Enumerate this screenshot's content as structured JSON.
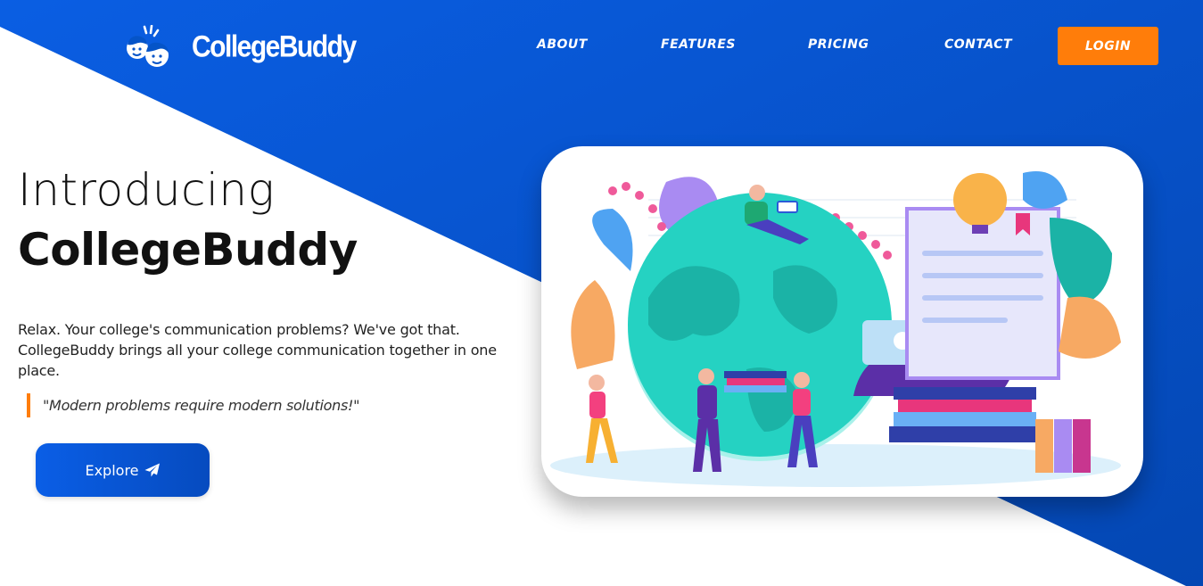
{
  "brand": {
    "name": "CollegeBuddy",
    "logo_icon": "two-faces-icon"
  },
  "nav": {
    "items": [
      {
        "label": "ABOUT"
      },
      {
        "label": "FEATURES"
      },
      {
        "label": "PRICING"
      },
      {
        "label": "CONTACT"
      }
    ],
    "login_label": "LOGIN"
  },
  "hero": {
    "title_line1": "Introducing",
    "title_line2": "CollegeBuddy",
    "description": "Relax. Your college's communication problems? We've got that. CollegeBuddy brings all your college communication together in one place.",
    "quote": "\"Modern problems require modern solutions!\"",
    "explore_label": "Explore",
    "explore_icon": "paper-plane-icon",
    "illustration": "students-globe-illustration"
  },
  "colors": {
    "primary_blue": "#0554c8",
    "accent_orange": "#ff7d0a",
    "text_dark": "#111111",
    "white": "#ffffff"
  }
}
